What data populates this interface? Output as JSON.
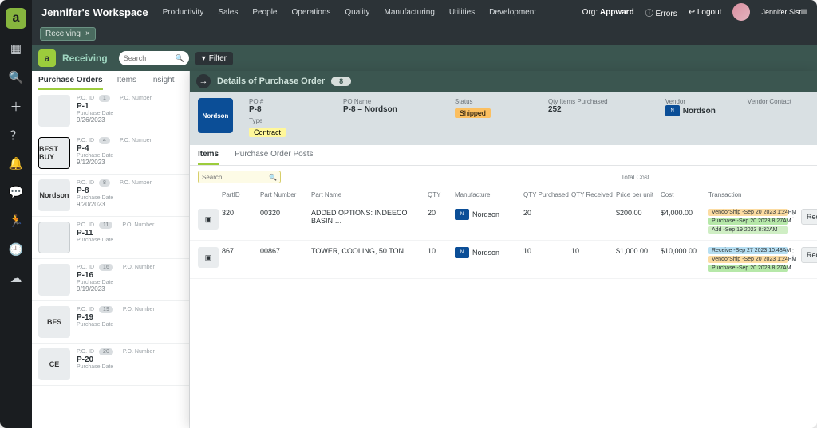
{
  "workspace": "Jennifer's Workspace",
  "topnav": [
    "Productivity",
    "Sales",
    "People",
    "Operations",
    "Quality",
    "Manufacturing",
    "Utilities",
    "Development"
  ],
  "org_label": "Org:",
  "org_name": "Appward",
  "errors": "Errors",
  "logout": "Logout",
  "username": "Jennifer Sistilli",
  "chip": "Receiving",
  "module": "Receiving",
  "module_search_ph": "Search",
  "filter": "Filter",
  "lefttabs": {
    "po": "Purchase Orders",
    "items": "Items",
    "insight": "Insight"
  },
  "po_labels": {
    "id": "P.O. ID",
    "num": "P.O. Number",
    "date": "Purchase Date"
  },
  "polist": [
    {
      "id": "1",
      "num": "P-1",
      "date": "9/26/2023",
      "thumb": "apple"
    },
    {
      "id": "4",
      "num": "P-4",
      "date": "9/12/2023",
      "thumb": "bb",
      "thumbtext": "BEST\nBUY"
    },
    {
      "id": "8",
      "num": "P-8",
      "date": "9/20/2023",
      "thumb": "nord",
      "thumbtext": "Nordson"
    },
    {
      "id": "11",
      "num": "P-11",
      "date": "",
      "thumb": "gear"
    },
    {
      "id": "16",
      "num": "P-16",
      "date": "9/19/2023",
      "thumb": "green"
    },
    {
      "id": "19",
      "num": "P-19",
      "date": "",
      "thumb": "bfs",
      "thumbtext": "BFS"
    },
    {
      "id": "20",
      "num": "P-20",
      "date": "",
      "thumb": "ce",
      "thumbtext": "CE"
    }
  ],
  "detail": {
    "title": "Details of Purchase Order",
    "count": "8",
    "labels": {
      "poid": "PO #",
      "poname": "PO Name",
      "status": "Status",
      "qty": "Qty Items Purchased",
      "vendor": "Vendor",
      "contact": "Vendor Contact",
      "type": "Type"
    },
    "poid": "P-8",
    "poname": "P-8 – Nordson",
    "status": "Shipped",
    "qty": "252",
    "vendor": "Nordson",
    "type": "Contract",
    "tabs": {
      "items": "Items",
      "posts": "Purchase Order Posts"
    },
    "search_ph": "Search",
    "total_cost": "Total Cost"
  },
  "cols": {
    "partid": "PartID",
    "partnum": "Part Number",
    "partname": "Part Name",
    "qty": "QTY",
    "mfg": "Manufacture",
    "qtyp": "QTY Purchased",
    "qtyr": "QTY Received",
    "ppu": "Price per unit",
    "cost": "Cost",
    "tx": "Transaction"
  },
  "rows": [
    {
      "partid": "320",
      "partnum": "00320",
      "partname": "ADDED OPTIONS: INDEECO BASIN …",
      "qty": "20",
      "mfg": "Nordson",
      "qtyp": "20",
      "qtyr": "",
      "ppu": "$200.00",
      "cost": "$4,000.00",
      "tx": [
        {
          "t": "VendorShip -Sep 20 2023 1:24PM",
          "c": "vendor"
        },
        {
          "t": "Purchase -Sep 20 2023 8:27AM",
          "c": "purchase"
        },
        {
          "t": "Add -Sep 19 2023 8:32AM",
          "c": "add"
        }
      ],
      "action": "Receive"
    },
    {
      "partid": "867",
      "partnum": "00867",
      "partname": "TOWER, COOLING, 50 TON",
      "qty": "10",
      "mfg": "Nordson",
      "qtyp": "10",
      "qtyr": "10",
      "ppu": "$1,000.00",
      "cost": "$10,000.00",
      "tx": [
        {
          "t": "Receive -Sep 27 2023 10:48AM",
          "c": "receive"
        },
        {
          "t": "VendorShip -Sep 20 2023 1:24PM",
          "c": "vendor"
        },
        {
          "t": "Purchase -Sep 20 2023 8:27AM",
          "c": "purchase"
        }
      ],
      "action": "Received"
    }
  ]
}
